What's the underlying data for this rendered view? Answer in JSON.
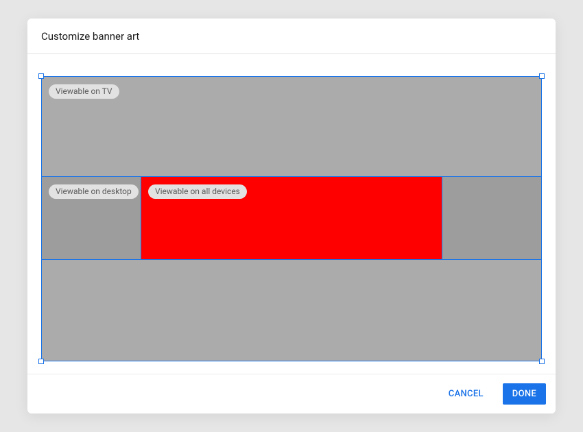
{
  "dialog": {
    "title": "Customize banner art",
    "zones": {
      "tv_label": "Viewable on TV",
      "desktop_label": "Viewable on desktop",
      "all_devices_label": "Viewable on all devices"
    },
    "buttons": {
      "cancel": "CANCEL",
      "done": "DONE"
    }
  }
}
